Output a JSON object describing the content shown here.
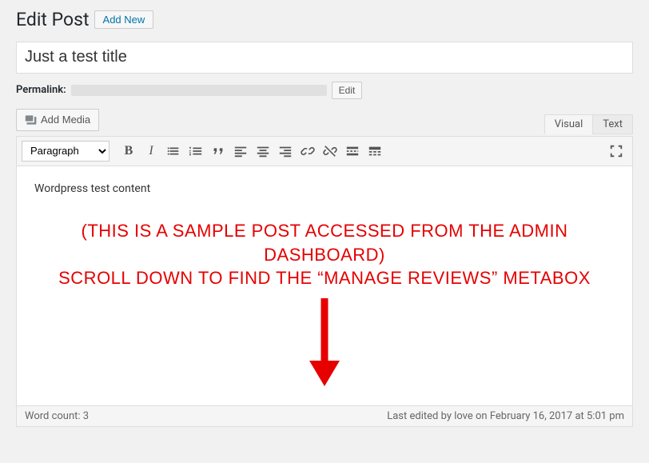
{
  "header": {
    "heading": "Edit Post",
    "add_new_label": "Add New"
  },
  "title_input": {
    "value": "Just a test title"
  },
  "permalink": {
    "label": "Permalink:",
    "edit_label": "Edit"
  },
  "media_button": {
    "label": "Add Media"
  },
  "editor": {
    "tabs": {
      "visual": "Visual",
      "text": "Text"
    },
    "format_select_value": "Paragraph",
    "content": "Wordpress test content"
  },
  "annotation": {
    "line1": "(This is a sample post accessed from the admin dashboard)",
    "line2": "Scroll down to find the “Manage Reviews” metabox"
  },
  "status": {
    "word_count_label": "Word count: 3",
    "last_edited": "Last edited by love on February 16, 2017 at 5:01 pm"
  },
  "toolbar_icons": {
    "bold": "B",
    "italic": "I"
  }
}
